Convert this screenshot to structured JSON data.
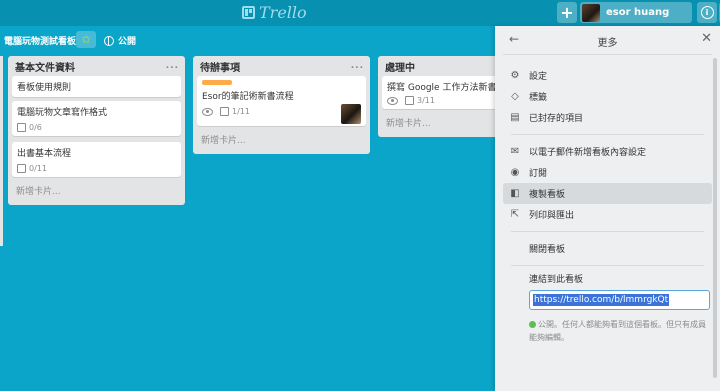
{
  "app": {
    "logo_text": "Trello"
  },
  "topbar": {
    "add_label": "+",
    "user_name": "esor huang",
    "info_label": "i",
    "bell_label": "🔔"
  },
  "board": {
    "title": "電腦玩物測試看板",
    "star": "✩",
    "visibility": "公開"
  },
  "lists": [
    {
      "title": "基本文件資料",
      "menu": "...",
      "cards": [
        {
          "title": "看板使用規則"
        },
        {
          "title": "電腦玩物文章寫作格式",
          "checklist": "0/6"
        },
        {
          "title": "出書基本流程",
          "checklist": "0/11"
        }
      ],
      "add_card": "新增卡片..."
    },
    {
      "title": "待辦事項",
      "menu": "...",
      "cards": [
        {
          "title": "Esor的筆記術新書流程",
          "checklist": "1/11"
        }
      ],
      "add_card": "新增卡片..."
    },
    {
      "title": "處理中",
      "menu": "...",
      "cards": [
        {
          "title": "撰寫 Google 工作方法新書",
          "checklist": "3/11"
        }
      ],
      "add_card": "新增卡片..."
    }
  ],
  "sidebar": {
    "back": "←",
    "title": "更多",
    "close": "✕",
    "items": [
      {
        "label": "設定",
        "icon": "gear-icon"
      },
      {
        "label": "標籤",
        "icon": "tag-icon"
      },
      {
        "label": "已封存的項目",
        "icon": "archive-icon"
      },
      {
        "label": "以電子郵件新增看板內容設定",
        "icon": "mail-icon"
      },
      {
        "label": "訂閱",
        "icon": "eye-icon"
      },
      {
        "label": "複製看板",
        "icon": "copy-icon"
      },
      {
        "label": "列印與匯出",
        "icon": "share-icon"
      }
    ],
    "close_board": "關閉看板",
    "link_label": "連結到此看板",
    "link_value": "https://trello.com/b/lmmrgkQt",
    "note": "公開。任何人都能夠看到這個看板。但只有成員能夠編輯。"
  },
  "colors": {
    "background": "#0aa5c8",
    "topbar": "#0890b1",
    "label_orange": "#ffab4a",
    "highlight": "#d6dadc"
  }
}
